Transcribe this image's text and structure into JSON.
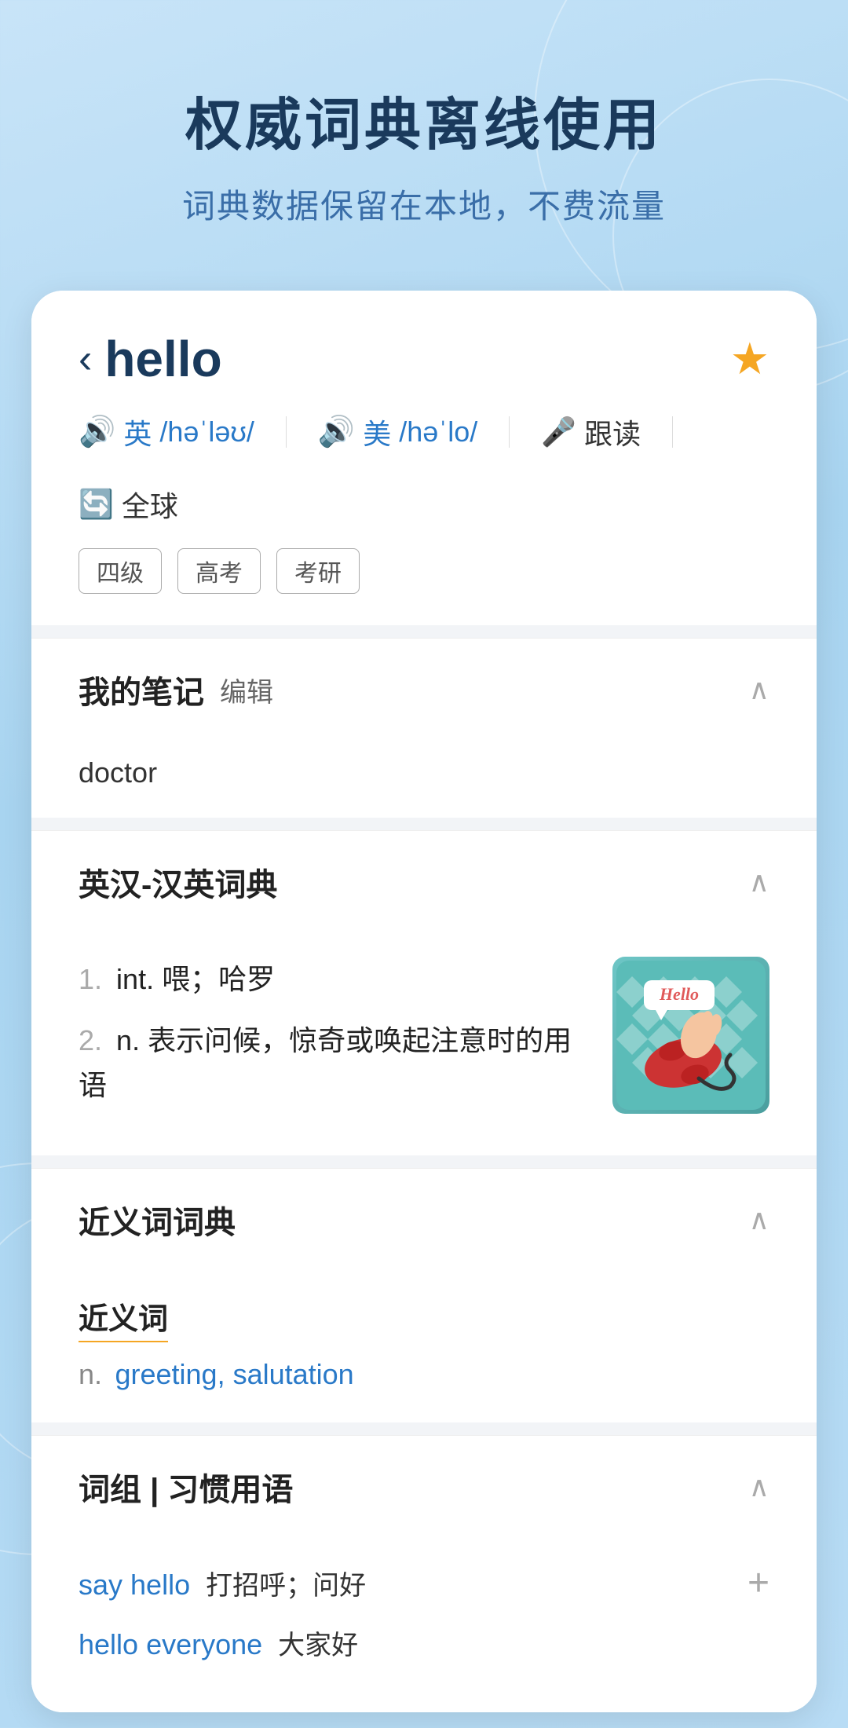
{
  "page": {
    "background": {
      "mainTitle": "权威词典离线使用",
      "subTitle": "词典数据保留在本地，不费流量"
    },
    "wordHeader": {
      "backLabel": "‹",
      "word": "hello",
      "starLabel": "★",
      "pronunciations": [
        {
          "lang": "英",
          "pron": "/həˈləʊ/",
          "iconLabel": "🔊"
        },
        {
          "lang": "美",
          "pron": "/həˈlo/",
          "iconLabel": "🔊"
        }
      ],
      "actions": [
        {
          "label": "跟读",
          "iconLabel": "🎤"
        },
        {
          "label": "全球",
          "iconLabel": "🔄"
        }
      ],
      "tags": [
        "四级",
        "高考",
        "考研"
      ]
    },
    "notesSection": {
      "title": "我的笔记",
      "editLabel": "编辑",
      "content": "doctor",
      "collapsed": false
    },
    "dictSection": {
      "title": "英汉-汉英词典",
      "definitions": [
        {
          "num": "1.",
          "pos": "int.",
          "meaning": "喂；哈罗"
        },
        {
          "num": "2.",
          "pos": "n.",
          "meaning": "表示问候，惊奇或唤起注意时的用语"
        }
      ],
      "collapsed": false
    },
    "synonymSection": {
      "title": "近义词词典",
      "label": "近义词",
      "pos": "n.",
      "words": "greeting, salutation",
      "collapsed": false
    },
    "phrasesSection": {
      "title": "词组 | 习惯用语",
      "phrases": [
        {
          "en": "say hello",
          "zh": "打招呼；问好"
        },
        {
          "en": "hello everyone",
          "zh": "大家好"
        }
      ],
      "collapsed": false
    }
  }
}
